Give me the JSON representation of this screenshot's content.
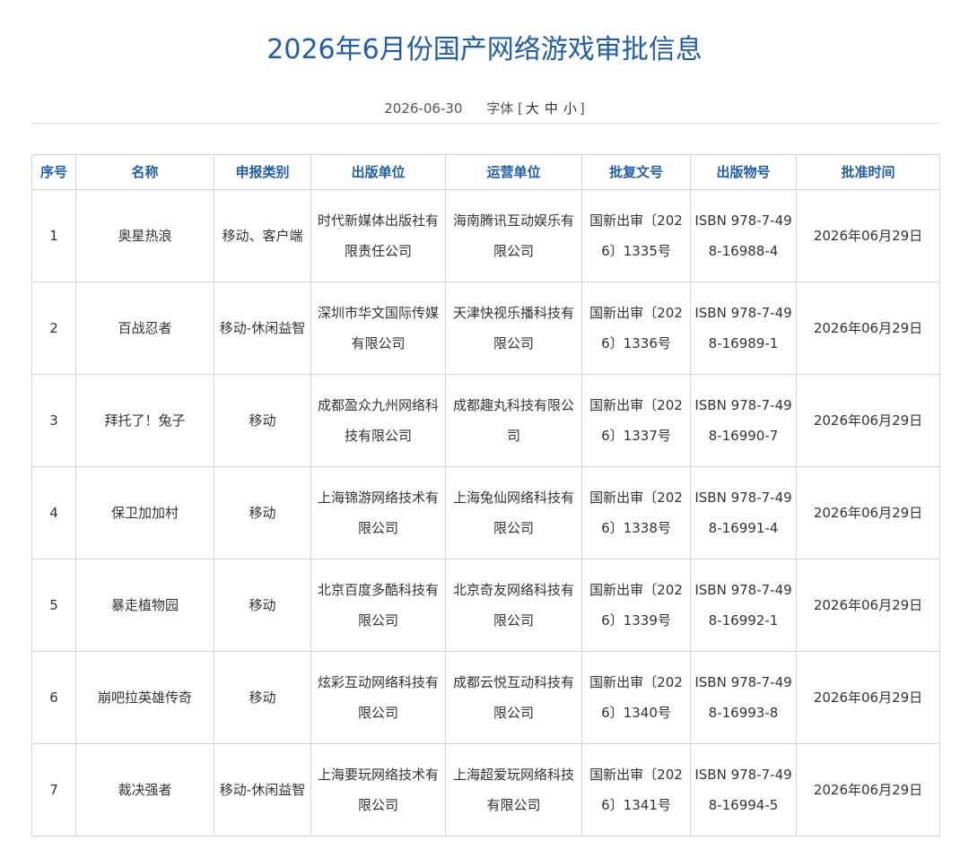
{
  "page": {
    "title": "2026年6月份国产网络游戏审批信息",
    "date": "2026-06-30",
    "font_label": "字体",
    "font_open": "[",
    "font_close": "]",
    "font_sizes": [
      "大",
      "中",
      "小"
    ],
    "title_color": "#1f5ea8"
  },
  "table": {
    "headers": [
      "序号",
      "名称",
      "申报类别",
      "出版单位",
      "运营单位",
      "批复文号",
      "出版物号",
      "批准时间"
    ],
    "rows": [
      [
        "1",
        "奥星热浪",
        "移动、客户端",
        "时代新媒体出版社有限责任公司",
        "海南腾讯互动娱乐有限公司",
        "国新出审〔2026〕1335号",
        "ISBN 978-7-498-16988-4",
        "2026年06月29日"
      ],
      [
        "2",
        "百战忍者",
        "移动-休闲益智",
        "深圳市华文国际传媒有限公司",
        "天津快视乐播科技有限公司",
        "国新出审〔2026〕1336号",
        "ISBN 978-7-498-16989-1",
        "2026年06月29日"
      ],
      [
        "3",
        "拜托了！兔子",
        "移动",
        "成都盈众九州网络科技有限公司",
        "成都趣丸科技有限公司",
        "国新出审〔2026〕1337号",
        "ISBN 978-7-498-16990-7",
        "2026年06月29日"
      ],
      [
        "4",
        "保卫加加村",
        "移动",
        "上海锦游网络技术有限公司",
        "上海兔仙网络科技有限公司",
        "国新出审〔2026〕1338号",
        "ISBN 978-7-498-16991-4",
        "2026年06月29日"
      ],
      [
        "5",
        "暴走植物园",
        "移动",
        "北京百度多酷科技有限公司",
        "北京奇友网络科技有限公司",
        "国新出审〔2026〕1339号",
        "ISBN 978-7-498-16992-1",
        "2026年06月29日"
      ],
      [
        "6",
        "崩吧拉英雄传奇",
        "移动",
        "炫彩互动网络科技有限公司",
        "成都云悦互动科技有限公司",
        "国新出审〔2026〕1340号",
        "ISBN 978-7-498-16993-8",
        "2026年06月29日"
      ],
      [
        "7",
        "裁决强者",
        "移动-休闲益智",
        "上海要玩网络技术有限公司",
        "上海超爱玩网络科技有限公司",
        "国新出审〔2026〕1341号",
        "ISBN 978-7-498-16994-5",
        "2026年06月29日"
      ]
    ]
  }
}
